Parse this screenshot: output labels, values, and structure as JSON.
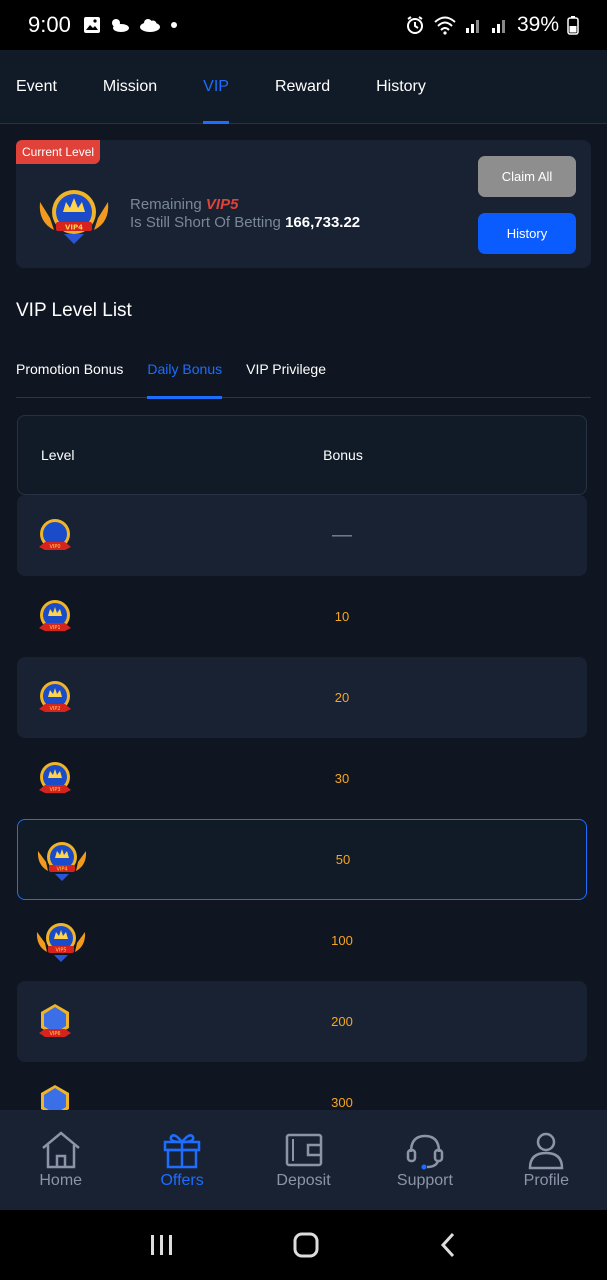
{
  "status_bar": {
    "time": "9:00",
    "battery": "39%"
  },
  "top_tabs": [
    {
      "label": "Event",
      "active": false
    },
    {
      "label": "Mission",
      "active": false
    },
    {
      "label": "VIP",
      "active": true
    },
    {
      "label": "Reward",
      "active": false
    },
    {
      "label": "History",
      "active": false
    }
  ],
  "level_card": {
    "badge": "Current Level",
    "remaining_prefix": "Remaining",
    "next_level": "VIP5",
    "short_text": "Is Still Short Of Betting",
    "amount": "166,733.22",
    "claim_all_label": "Claim All",
    "history_label": "History"
  },
  "section_title": "VIP Level List",
  "sub_tabs": [
    {
      "label": "Promotion Bonus",
      "active": false
    },
    {
      "label": "Daily Bonus",
      "active": true
    },
    {
      "label": "VIP Privilege",
      "active": false
    }
  ],
  "table": {
    "headers": {
      "level": "Level",
      "bonus": "Bonus"
    },
    "rows": [
      {
        "bonus": "—",
        "emblem": "vip0-emblem",
        "selected": false
      },
      {
        "bonus": "10",
        "emblem": "vip1-emblem",
        "selected": false
      },
      {
        "bonus": "20",
        "emblem": "vip2-emblem",
        "selected": false
      },
      {
        "bonus": "30",
        "emblem": "vip3-emblem",
        "selected": false
      },
      {
        "bonus": "50",
        "emblem": "vip4-emblem",
        "selected": true
      },
      {
        "bonus": "100",
        "emblem": "vip5-emblem",
        "selected": false
      },
      {
        "bonus": "200",
        "emblem": "vip6-emblem",
        "selected": false
      },
      {
        "bonus": "300",
        "emblem": "vip7-emblem",
        "selected": false
      }
    ]
  },
  "bottom_nav": [
    {
      "label": "Home",
      "icon": "home-icon",
      "active": false
    },
    {
      "label": "Offers",
      "icon": "gift-icon",
      "active": true
    },
    {
      "label": "Deposit",
      "icon": "wallet-icon",
      "active": false
    },
    {
      "label": "Support",
      "icon": "headset-icon",
      "active": false
    },
    {
      "label": "Profile",
      "icon": "profile-icon",
      "active": false
    }
  ],
  "colors": {
    "accent": "#1d6dff",
    "bonus": "#f5a623",
    "badge": "#e0423a",
    "background": "#0f1621",
    "card": "#182232"
  }
}
